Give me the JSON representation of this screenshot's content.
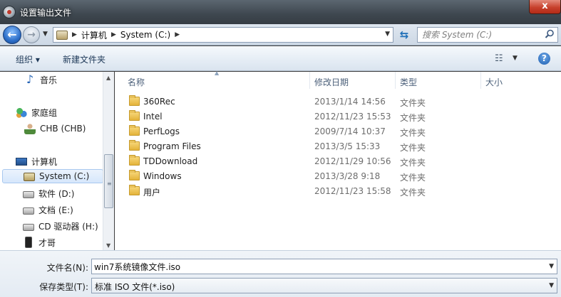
{
  "window": {
    "title": "设置输出文件",
    "close_label": "x"
  },
  "navbar": {
    "breadcrumbs": [
      "计算机",
      "System (C:)"
    ],
    "search_placeholder": "搜索 System (C:)"
  },
  "toolbar": {
    "organize_label": "组织 ▾",
    "new_folder_label": "新建文件夹"
  },
  "nav_pane": {
    "items": [
      {
        "label": "音乐",
        "icon": "music-icon"
      },
      {
        "label": "家庭组",
        "icon": "homegroup-icon"
      },
      {
        "label": "CHB (CHB)",
        "icon": "user-icon"
      },
      {
        "label": "计算机",
        "icon": "computer-icon"
      },
      {
        "label": "System (C:)",
        "icon": "system-drive-icon",
        "selected": true
      },
      {
        "label": "软件 (D:)",
        "icon": "drive-icon"
      },
      {
        "label": "文档 (E:)",
        "icon": "drive-icon"
      },
      {
        "label": "CD 驱动器 (H:)",
        "icon": "cd-drive-icon"
      },
      {
        "label": "才哥",
        "icon": "phone-icon"
      }
    ]
  },
  "file_list": {
    "columns": [
      "名称",
      "修改日期",
      "类型",
      "大小"
    ],
    "rows": [
      {
        "name": "360Rec",
        "date": "2013/1/14 14:56",
        "type": "文件夹"
      },
      {
        "name": "Intel",
        "date": "2012/11/23 15:53",
        "type": "文件夹"
      },
      {
        "name": "PerfLogs",
        "date": "2009/7/14 10:37",
        "type": "文件夹"
      },
      {
        "name": "Program Files",
        "date": "2013/3/5 15:33",
        "type": "文件夹"
      },
      {
        "name": "TDDownload",
        "date": "2012/11/29 10:56",
        "type": "文件夹"
      },
      {
        "name": "Windows",
        "date": "2013/3/28 9:18",
        "type": "文件夹"
      },
      {
        "name": "用户",
        "date": "2012/11/23 15:58",
        "type": "文件夹"
      }
    ]
  },
  "bottom": {
    "filename_label": "文件名(N):",
    "filename_value": "win7系统镜像文件.iso",
    "filetype_label": "保存类型(T):",
    "filetype_value": "标准 ISO 文件(*.iso)"
  }
}
